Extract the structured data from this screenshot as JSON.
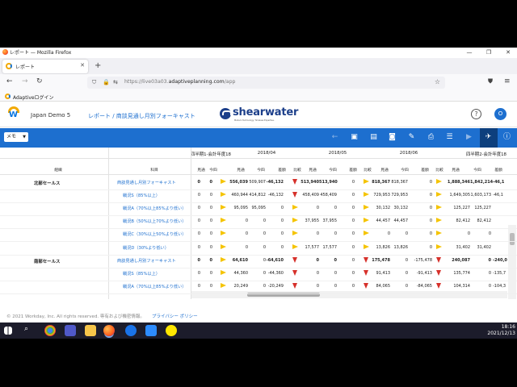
{
  "browser": {
    "window_title": "レポート — Mozilla Firefox",
    "tab_title": "レポート",
    "url_prefix": "https://live03a03.",
    "url_host": "adaptiveplanning.com",
    "url_suffix": "/app",
    "bookmark": "Adaptiveログイン"
  },
  "app": {
    "company": "Japan Demo 5",
    "breadcrumb": "レポート / 商談見通し月別フォーキャスト",
    "logo_text": "shearwater",
    "logo_tagline": "Modern Technology. Timeless Expertise.",
    "help_icon": "?",
    "avatar_initial": "O"
  },
  "toolbar": {
    "menu_label": "メモ"
  },
  "grid": {
    "header_left": "組織",
    "header_account": "科目",
    "periods": [
      "四半期1-会計年度18",
      "2018/04",
      "2018/05",
      "2018/06",
      "四半期2-会計年度18"
    ],
    "column_labels": [
      "見通",
      "今四",
      "差額",
      "比較"
    ],
    "groups": [
      {
        "name": "北部セールス",
        "rows": [
          {
            "label": "商談見通し月別フォーキャスト",
            "q1": [
              "0",
              "0"
            ],
            "q1_arrow": "right",
            "apr": [
              "556,039",
              "509,907",
              "-46,132"
            ],
            "apr_arrow": "down",
            "may": [
              "513,940",
              "513,940",
              "0"
            ],
            "may_arrow": "right",
            "jun": [
              "818,367",
              "818,367",
              "0"
            ],
            "jun_arrow": "right",
            "q2": [
              "1,888,346",
              "1,842,214",
              "-46,1"
            ],
            "bold": true
          },
          {
            "label": "戦況S（85%以上）",
            "q1": [
              "0",
              "0"
            ],
            "q1_arrow": "right",
            "apr": [
              "460,944",
              "414,812",
              "-46,132"
            ],
            "apr_arrow": "down",
            "may": [
              "458,409",
              "458,409",
              "0"
            ],
            "may_arrow": "right",
            "jun": [
              "729,953",
              "729,953",
              "0"
            ],
            "jun_arrow": "right",
            "q2": [
              "1,649,305",
              "1,603,173",
              "-46,1"
            ]
          },
          {
            "label": "戦況A（70%以上85%より低い）",
            "q1": [
              "0",
              "0"
            ],
            "q1_arrow": "right",
            "apr": [
              "95,095",
              "95,095",
              "0"
            ],
            "apr_arrow": "right",
            "may": [
              "0",
              "0",
              "0"
            ],
            "may_arrow": "right",
            "jun": [
              "30,132",
              "30,132",
              "0"
            ],
            "jun_arrow": "right",
            "q2": [
              "125,227",
              "125,227",
              ""
            ]
          },
          {
            "label": "戦況B（50%以上70%より低い）",
            "q1": [
              "0",
              "0"
            ],
            "q1_arrow": "right",
            "apr": [
              "0",
              "0",
              "0"
            ],
            "apr_arrow": "right",
            "may": [
              "37,955",
              "37,955",
              "0"
            ],
            "may_arrow": "right",
            "jun": [
              "44,457",
              "44,457",
              "0"
            ],
            "jun_arrow": "right",
            "q2": [
              "82,412",
              "82,412",
              ""
            ]
          },
          {
            "label": "戦況C（30%以上50%より低い）",
            "q1": [
              "0",
              "0"
            ],
            "q1_arrow": "right",
            "apr": [
              "0",
              "0",
              "0"
            ],
            "apr_arrow": "right",
            "may": [
              "0",
              "0",
              "0"
            ],
            "may_arrow": "right",
            "jun": [
              "0",
              "0",
              "0"
            ],
            "jun_arrow": "right",
            "q2": [
              "0",
              "0",
              ""
            ]
          },
          {
            "label": "戦況D（30%より低い）",
            "q1": [
              "0",
              "0"
            ],
            "q1_arrow": "right",
            "apr": [
              "0",
              "0",
              "0"
            ],
            "apr_arrow": "right",
            "may": [
              "17,577",
              "17,577",
              "0"
            ],
            "may_arrow": "right",
            "jun": [
              "13,826",
              "13,826",
              "0"
            ],
            "jun_arrow": "right",
            "q2": [
              "31,402",
              "31,402",
              ""
            ]
          }
        ]
      },
      {
        "name": "南部セールス",
        "rows": [
          {
            "label": "商談見通し月別フォーキャスト",
            "q1": [
              "0",
              "0"
            ],
            "q1_arrow": "right",
            "apr": [
              "64,610",
              "0",
              "-64,610"
            ],
            "apr_arrow": "down",
            "may": [
              "0",
              "0",
              "0"
            ],
            "may_arrow": "down",
            "jun": [
              "175,478",
              "0",
              "-175,478"
            ],
            "jun_arrow": "down",
            "q2": [
              "240,087",
              "0",
              "-240,0"
            ],
            "bold": true
          },
          {
            "label": "戦況S（85%以上）",
            "q1": [
              "0",
              "0"
            ],
            "q1_arrow": "right",
            "apr": [
              "44,360",
              "0",
              "-44,360"
            ],
            "apr_arrow": "down",
            "may": [
              "0",
              "0",
              "0"
            ],
            "may_arrow": "down",
            "jun": [
              "91,413",
              "0",
              "-91,413"
            ],
            "jun_arrow": "down",
            "q2": [
              "135,774",
              "0",
              "-135,7"
            ]
          },
          {
            "label": "戦況A（70%以上85%より低い）",
            "q1": [
              "0",
              "0"
            ],
            "q1_arrow": "right",
            "apr": [
              "20,249",
              "0",
              "-20,249"
            ],
            "apr_arrow": "down",
            "may": [
              "0",
              "0",
              "0"
            ],
            "may_arrow": "down",
            "jun": [
              "84,065",
              "0",
              "-84,065"
            ],
            "jun_arrow": "down",
            "q2": [
              "104,314",
              "0",
              "-104,3"
            ]
          }
        ]
      }
    ]
  },
  "footer": {
    "copyright": "© 2021 Workday, Inc. All rights reserved. 専有および機密情報。",
    "privacy": "プライバシー ポリシー"
  },
  "taskbar": {
    "time": "18:16",
    "date": "2021/12/13"
  }
}
